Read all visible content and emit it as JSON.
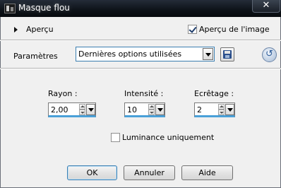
{
  "window": {
    "title": "Masque flou",
    "close_glyph": "✕"
  },
  "preview": {
    "label": "Aperçu",
    "image_preview_label": "Aperçu de l'image",
    "image_preview_checked": true
  },
  "presets": {
    "label": "Paramètres",
    "selected": "Dernières options utilisées"
  },
  "fields": {
    "radius": {
      "label": "Rayon :",
      "value": "2,00"
    },
    "intensity": {
      "label": "Intensité :",
      "value": "10"
    },
    "clipping": {
      "label": "Ecrêtage :",
      "value": "2"
    }
  },
  "luminance": {
    "label": "Luminance uniquement",
    "checked": false
  },
  "buttons": {
    "ok": "OK",
    "cancel": "Annuler",
    "help": "Aide"
  },
  "icons": {
    "save": "floppy-disk-icon",
    "reset": "reset-icon",
    "app": "app-icon"
  }
}
